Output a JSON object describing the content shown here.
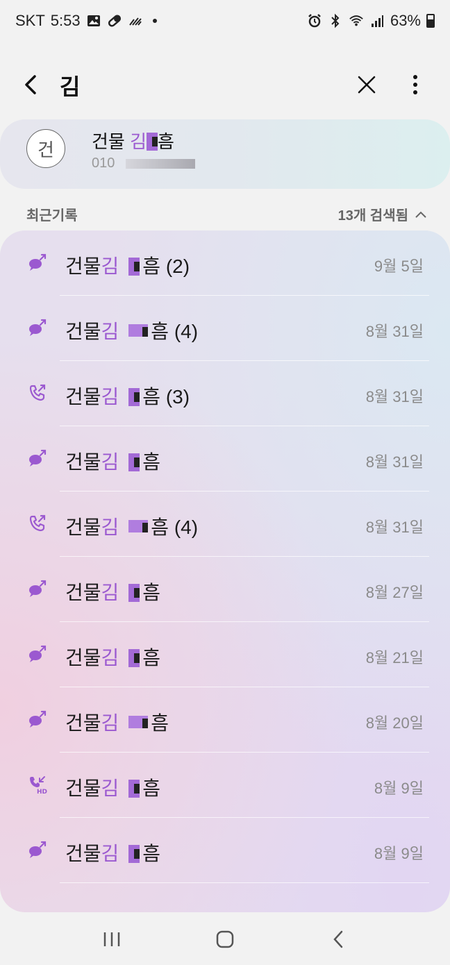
{
  "status_bar": {
    "carrier": "SKT",
    "time": "5:53",
    "battery": "63%",
    "left_icons": [
      "image-icon",
      "pill-icon",
      "signal-waves-icon"
    ],
    "right_icons": [
      "alarm-icon",
      "bluetooth-icon",
      "wifi-icon",
      "cellular-signal-icon",
      "battery-icon"
    ]
  },
  "header": {
    "search_value": "김",
    "back_icon": "chevron-left-icon",
    "clear_icon": "close-icon",
    "more_icon": "more-vertical-icon"
  },
  "contact": {
    "avatar_initial": "건",
    "name_prefix": "건물",
    "name_highlight": "김",
    "name_suffix": "흠",
    "number_prefix": "010"
  },
  "section": {
    "label": "최근기록",
    "count": "13개 검색됨",
    "toggle_icon": "chevron-up-icon"
  },
  "accent_color": "#9b59d0",
  "call_log": [
    {
      "type": "message",
      "icon": "message-out-icon",
      "prefix": "건물",
      "highlight": "김",
      "suffix": "흠 (2)",
      "date": "9월 5일"
    },
    {
      "type": "message",
      "icon": "message-out-icon",
      "prefix": "건물",
      "highlight": "김",
      "suffix": "흠 (4)",
      "date": "8월 31일"
    },
    {
      "type": "call",
      "icon": "call-out-icon",
      "prefix": "건물",
      "highlight": "김",
      "suffix": "흠 (3)",
      "date": "8월 31일"
    },
    {
      "type": "message",
      "icon": "message-out-icon",
      "prefix": "건물",
      "highlight": "김",
      "suffix": "흠",
      "date": "8월 31일"
    },
    {
      "type": "call",
      "icon": "call-out-icon",
      "prefix": "건물",
      "highlight": "김",
      "suffix": "흠 (4)",
      "date": "8월 31일"
    },
    {
      "type": "message",
      "icon": "message-out-icon",
      "prefix": "건물",
      "highlight": "김",
      "suffix": "흠",
      "date": "8월 27일"
    },
    {
      "type": "message",
      "icon": "message-out-icon",
      "prefix": "건물",
      "highlight": "김",
      "suffix": "흠",
      "date": "8월 21일"
    },
    {
      "type": "message",
      "icon": "message-out-icon",
      "prefix": "건물",
      "highlight": "김",
      "suffix": "흠",
      "date": "8월 20일"
    },
    {
      "type": "call",
      "icon": "call-in-hd-icon",
      "prefix": "건물",
      "highlight": "김",
      "suffix": "흠",
      "date": "8월 9일"
    },
    {
      "type": "message",
      "icon": "message-out-icon",
      "prefix": "건물",
      "highlight": "김",
      "suffix": "흠",
      "date": "8월 9일"
    }
  ],
  "nav_bar": {
    "recents_icon": "recents-icon",
    "home_icon": "home-icon",
    "back_icon": "back-icon"
  }
}
